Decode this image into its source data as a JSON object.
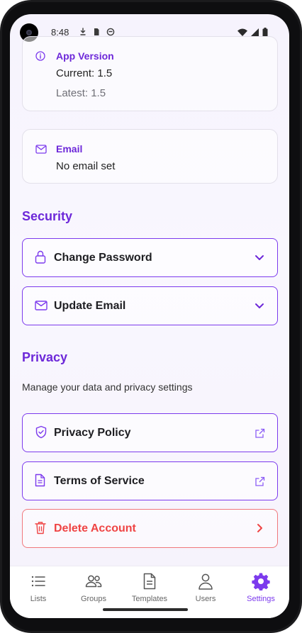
{
  "status_bar": {
    "time": "8:48"
  },
  "app_version": {
    "title": "App Version",
    "current": "Current: 1.5",
    "latest": "Latest: 1.5"
  },
  "email_card": {
    "title": "Email",
    "value": "No email set"
  },
  "security": {
    "title": "Security",
    "items": [
      {
        "label": "Change Password",
        "icon": "lock-icon",
        "trail": "chevron-down-icon"
      },
      {
        "label": "Update Email",
        "icon": "mail-icon",
        "trail": "chevron-down-icon"
      }
    ]
  },
  "privacy": {
    "title": "Privacy",
    "description": "Manage your data and privacy settings",
    "items": [
      {
        "label": "Privacy Policy",
        "icon": "shield-check-icon",
        "trail": "external-link-icon"
      },
      {
        "label": "Terms of Service",
        "icon": "document-icon",
        "trail": "external-link-icon"
      }
    ]
  },
  "delete_account": {
    "label": "Delete Account",
    "icon": "trash-icon",
    "trail": "chevron-right-icon"
  },
  "bottom_nav": {
    "items": [
      {
        "label": "Lists",
        "icon": "list-icon"
      },
      {
        "label": "Groups",
        "icon": "groups-icon"
      },
      {
        "label": "Templates",
        "icon": "templates-icon"
      },
      {
        "label": "Users",
        "icon": "user-icon"
      },
      {
        "label": "Settings",
        "icon": "settings-gear-icon",
        "active": true
      }
    ]
  },
  "colors": {
    "accent": "#7c3aed",
    "accent_text": "#6d28d9",
    "danger": "#ef4444",
    "danger_border": "#f0787c"
  }
}
